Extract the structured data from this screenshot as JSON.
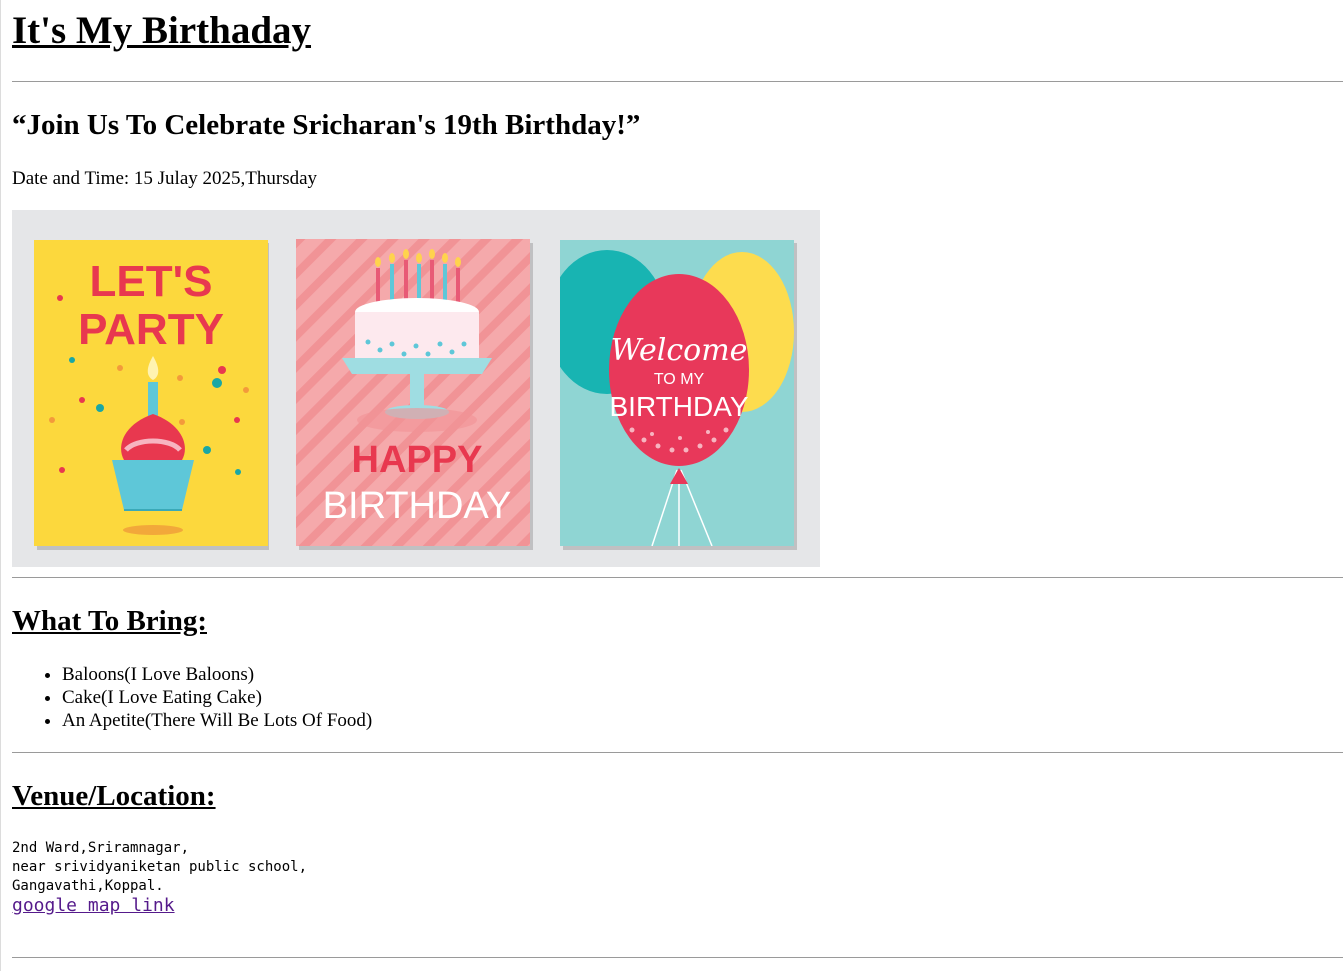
{
  "page": {
    "title": "It's My Birthaday",
    "invitation": "“Join Us To Celebrate Sricharan's 19th Birthday!”",
    "date_time": "Date and Time: 15 Julay 2025,Thursday"
  },
  "banner": {
    "card1": {
      "line1": "LET'S",
      "line2": "PARTY",
      "background": "#fcd83d"
    },
    "card2": {
      "line1": "HAPPY",
      "line2": "BIRTHDAY",
      "background": "#f5a9ab"
    },
    "card3": {
      "line1": "Welcome",
      "line2": "TO MY",
      "line3": "BIRTHDAY",
      "background": "#8fd5d3"
    }
  },
  "bring": {
    "heading": "What To Bring:",
    "items": [
      "Baloons(I Love Baloons)",
      "Cake(I Love Eating Cake)",
      "An Apetite(There Will Be Lots Of Food)"
    ]
  },
  "venue": {
    "heading": "Venue/Location:",
    "address": "2nd Ward,Sriramnagar,\nnear srividyaniketan public school,\nGangavathi,Koppal.",
    "link_text": "google map link",
    "link_color": "#551a8b"
  }
}
